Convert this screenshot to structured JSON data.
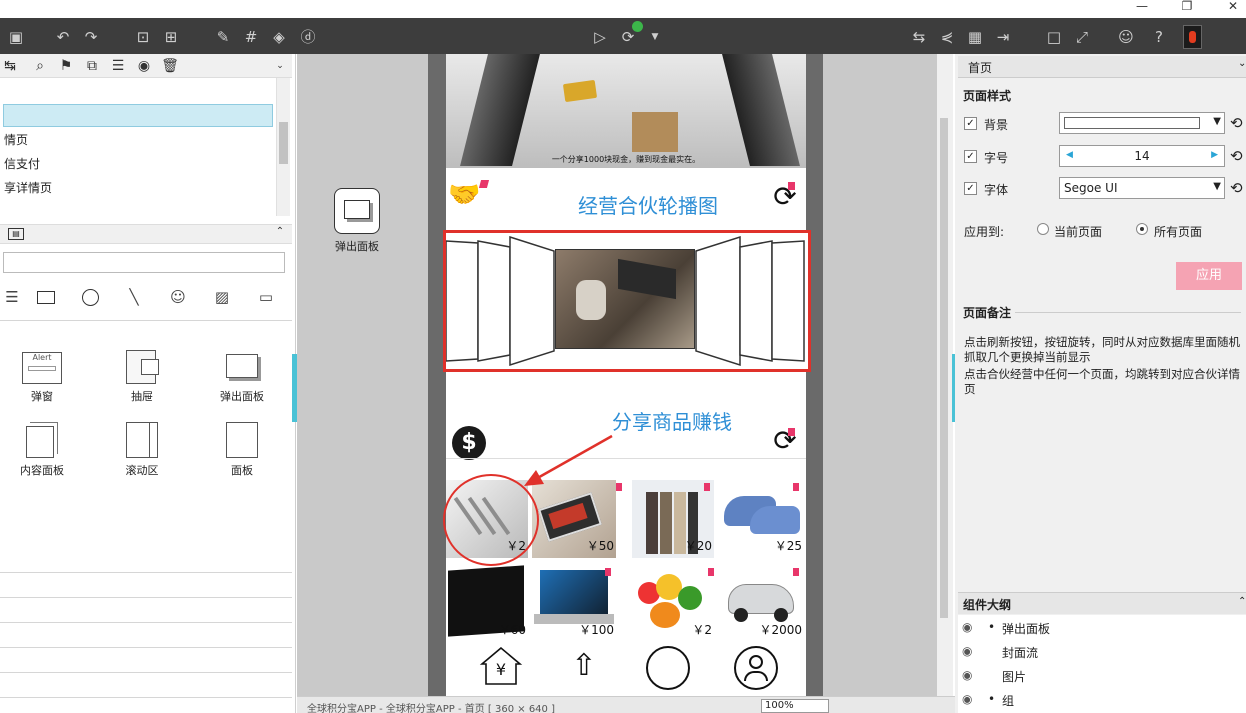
{
  "toolbar": {
    "window_minimize": "—",
    "window_restore": "❐",
    "window_close": "✕"
  },
  "left": {
    "pages": [
      "情页",
      "信支付",
      "享详情页"
    ],
    "widgets": [
      {
        "name": "弹窗",
        "icon_text": "Alert"
      },
      {
        "name": "抽屉"
      },
      {
        "name": "弹出面板"
      },
      {
        "name": "内容面板"
      },
      {
        "name": "滚动区"
      },
      {
        "name": "面板"
      }
    ]
  },
  "canvas": {
    "popup_panel_label": "弹出面板",
    "banner_caption": "一个分享1000块现金，赚到现金最实在。",
    "section1_title": "经营合伙轮播图",
    "section2_title": "分享商品赚钱",
    "products": [
      {
        "name": "餐具",
        "price": "￥2"
      },
      {
        "name": "手机",
        "price": "￥50"
      },
      {
        "name": "衣服",
        "price": "￥20"
      },
      {
        "name": "鞋子",
        "price": "￥25"
      },
      {
        "name": "电视",
        "price": "￥60"
      },
      {
        "name": "笔记本",
        "price": "￥100"
      },
      {
        "name": "水果",
        "price": "￥2"
      },
      {
        "name": "汽车",
        "price": "￥2000"
      }
    ],
    "dollar_symbol": "$",
    "yen_symbol": "¥"
  },
  "status": {
    "breadcrumb": "全球积分宝APP - 全球积分宝APP - 首页 [ 360 × 640 ]",
    "zoom": "100%"
  },
  "right": {
    "tab": "首页",
    "style_header": "页面样式",
    "bg_label": "背景",
    "font_size_label": "字号",
    "font_size_value": "14",
    "font_label": "字体",
    "font_value": "Segoe UI",
    "apply_to_label": "应用到:",
    "option_current": "当前页面",
    "option_all": "所有页面",
    "apply_button": "应用",
    "notes_header": "页面备注",
    "notes_line1": "点击刷新按钮，按钮旋转，同时从对应数据库里面随机抓取几个更换掉当前显示",
    "notes_line2": "点击合伙经营中任何一个页面，均跳转到对应合伙详情页",
    "outline_header": "组件大纲",
    "outline_items": [
      "弹出面板",
      "封面流",
      "图片",
      "组"
    ]
  },
  "colors": {
    "toolbar_bg": "#3d3d3d",
    "accent_blue": "#2f8fd6",
    "highlight_red": "#e0312a",
    "apply_pink": "#f5a3b3",
    "selected_row": "#cdebf4"
  }
}
